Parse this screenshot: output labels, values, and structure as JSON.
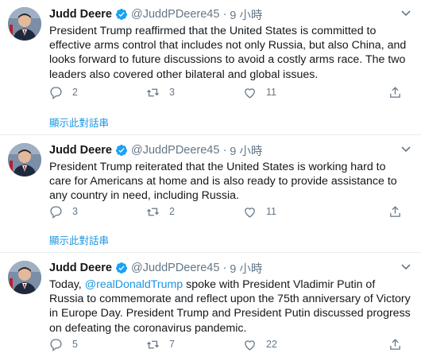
{
  "tweets": [
    {
      "name": "Judd Deere",
      "handle": "@JuddPDeere45",
      "dot": "·",
      "time": "9 小時",
      "text": "President Trump reaffirmed that the United States is committed to\neffective arms control that includes not only Russia, but also China, and\nlooks forward to future discussions to avoid a costly arms race.  The two\nleaders also covered other bilateral and global issues.",
      "reply_count": "2",
      "retweet_count": "3",
      "like_count": "11",
      "show_thread": "顯示此對話串"
    },
    {
      "name": "Judd Deere",
      "handle": "@JuddPDeere45",
      "dot": "·",
      "time": "9 小時",
      "text": "President Trump reiterated that the United States is working hard to\ncare for Americans at home and is also ready to provide assistance to\nany country in need, including Russia.",
      "reply_count": "3",
      "retweet_count": "2",
      "like_count": "11",
      "show_thread": "顯示此對話串"
    },
    {
      "name": "Judd Deere",
      "handle": "@JuddPDeere45",
      "dot": "·",
      "time": "9 小時",
      "text_before": "Today, ",
      "mention": "@realDonaldTrump",
      "text_after": " spoke with President Vladimir Putin of\nRussia to commemorate and reflect upon the 75th anniversary of Victory\nin Europe Day. President Trump and President Putin discussed progress\non defeating the coronavirus pandemic.",
      "reply_count": "5",
      "retweet_count": "7",
      "like_count": "22"
    }
  ],
  "colors": {
    "accent": "#1b95e0",
    "muted": "#657786",
    "text": "#14171a",
    "verified": "#1da1f2",
    "divider": "#e6ecf0"
  },
  "icons": [
    "verified-badge-icon",
    "chevron-down-icon",
    "reply-icon",
    "retweet-icon",
    "like-icon",
    "share-icon"
  ]
}
